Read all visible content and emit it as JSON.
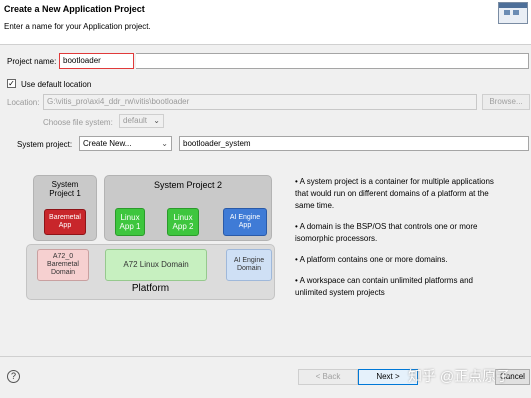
{
  "header": {
    "title": "Create a New Application Project",
    "subtitle": "Enter a name for your Application project."
  },
  "form": {
    "project_name_label": "Project name:",
    "project_name_value": "bootloader",
    "use_default_location_label": "Use default location",
    "use_default_location_checked": true,
    "location_label": "Location:",
    "location_value": "G:\\vitis_pro\\axi4_ddr_rw\\vitis\\bootloader",
    "browse_label": "Browse...",
    "choose_fs_label": "Choose file system:",
    "choose_fs_value": "default",
    "system_project_label": "System project:",
    "system_project_value": "Create New...",
    "system_project_name": "bootloader_system"
  },
  "diagram": {
    "system_project_1": "System Project 1",
    "system_project_2": "System Project 2",
    "baremetal_app": "Baremetal App",
    "linux_app_1": "Linux App 1",
    "linux_app_2": "Linux App 2",
    "ai_engine_app": "AI Engine App",
    "a72_baremetal_domain": "A72_0 Baremetal Domain",
    "a72_linux_domain": "A72 Linux Domain",
    "ai_engine_domain": "AI Engine Domain",
    "platform": "Platform"
  },
  "info": [
    "• A system project is a container for multiple applications that would run on different domains of a platform at the same time.",
    "• A domain is the BSP/OS that controls one or more isomorphic processors.",
    "• A platform contains one or more domains.",
    "• A workspace can contain unlimited platforms and unlimited system projects"
  ],
  "footer": {
    "back_label": "< Back",
    "next_label": "Next >",
    "cancel_label": "Cancel",
    "help_icon": "help-icon",
    "watermark": "知乎 @正点原子"
  },
  "colors": {
    "baremetal_red": "#c8262b",
    "linux_green": "#3ec63e",
    "ai_blue": "#3f7bd6",
    "highlight_red": "#e03a3a"
  }
}
